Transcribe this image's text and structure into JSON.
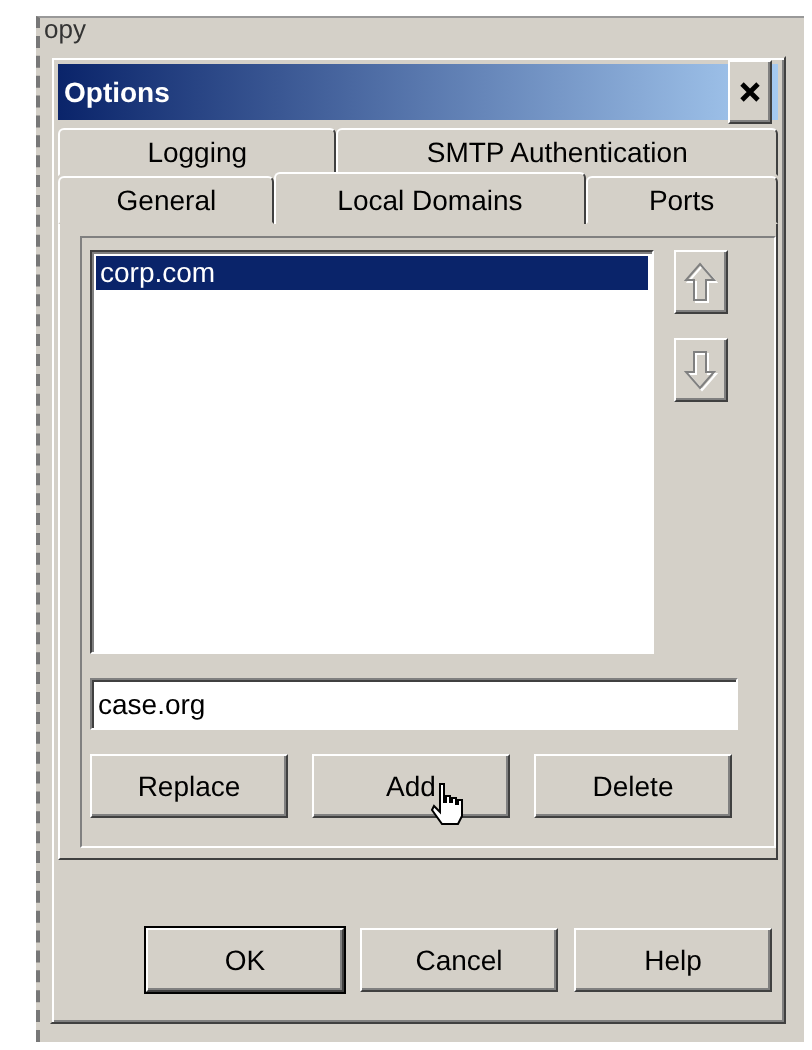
{
  "background_text": "opy",
  "window": {
    "title": "Options"
  },
  "tab_rows": [
    [
      {
        "label": "Logging",
        "selected": false
      },
      {
        "label": "SMTP Authentication",
        "selected": false
      }
    ],
    [
      {
        "label": "General",
        "selected": false
      },
      {
        "label": "Local Domains",
        "selected": true
      },
      {
        "label": "Ports",
        "selected": false
      }
    ]
  ],
  "domains": [
    {
      "label": "corp.com",
      "selected": true
    }
  ],
  "move_buttons": [
    {
      "kind": "up",
      "disabled": true
    },
    {
      "kind": "down",
      "disabled": true
    }
  ],
  "domain_field": {
    "value": "case.org"
  },
  "list_buttons": [
    "Replace",
    "Add",
    "Delete"
  ],
  "dialog_buttons": [
    {
      "label": "OK",
      "default": true
    },
    {
      "label": "Cancel",
      "default": false
    },
    {
      "label": "Help",
      "default": false
    }
  ]
}
